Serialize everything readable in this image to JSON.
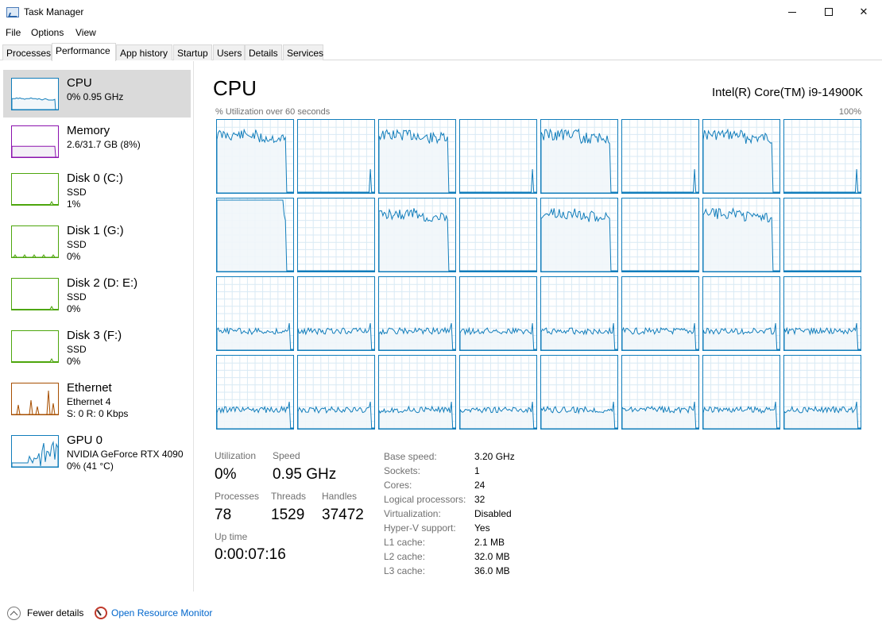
{
  "window": {
    "title": "Task Manager"
  },
  "menu": [
    "File",
    "Options",
    "View"
  ],
  "tabs": [
    "Processes",
    "Performance",
    "App history",
    "Startup",
    "Users",
    "Details",
    "Services"
  ],
  "active_tab": "Performance",
  "sidebar": [
    {
      "name": "CPU",
      "sub1": "0%  0.95 GHz",
      "sub2": "",
      "color": "#117dbb",
      "fill": "#f1f6fa",
      "shape": [
        8,
        8,
        8,
        7,
        8,
        7,
        8,
        8,
        9,
        8,
        8,
        8,
        7,
        8,
        8,
        8,
        9,
        8,
        9,
        10,
        9,
        8,
        9,
        10,
        10,
        10,
        10,
        9,
        40,
        41
      ]
    },
    {
      "name": "Memory",
      "sub1": "2.6/31.7 GB (8%)",
      "sub2": "",
      "color": "#8b12ae",
      "fill": "#f4f0f7",
      "shape": [
        8,
        8,
        8,
        8,
        8,
        8,
        8,
        8,
        8,
        8,
        8,
        8,
        8,
        8,
        8,
        8,
        8,
        8,
        8,
        8,
        8,
        8,
        8,
        8,
        8,
        8,
        8,
        8,
        34,
        34
      ]
    },
    {
      "name": "Disk 0 (C:)",
      "sub1": "SSD",
      "sub2": "1%",
      "color": "#4da60c",
      "fill": "#eff7ea",
      "shape": []
    },
    {
      "name": "Disk 1 (G:)",
      "sub1": "SSD",
      "sub2": "0%",
      "color": "#4da60c",
      "fill": "#eff7ea",
      "shape": []
    },
    {
      "name": "Disk 2 (D: E:)",
      "sub1": "SSD",
      "sub2": "0%",
      "color": "#4da60c",
      "fill": "#eff7ea",
      "shape": []
    },
    {
      "name": "Disk 3 (F:)",
      "sub1": "SSD",
      "sub2": "0%",
      "color": "#4da60c",
      "fill": "#eff7ea",
      "shape": []
    },
    {
      "name": "Ethernet",
      "sub1": "Ethernet 4",
      "sub2": "S: 0  R: 0 Kbps",
      "color": "#a74f01",
      "fill": "#fcf3eb",
      "shape": []
    },
    {
      "name": "GPU 0",
      "sub1": "NVIDIA GeForce RTX 4090",
      "sub2": "0%  (41 °C)",
      "color": "#117dbb",
      "fill": "#f1f6fa",
      "shape": []
    }
  ],
  "header": {
    "title": "CPU",
    "model": "Intel(R) Core(TM) i9-14900K",
    "util_label": "% Utilization over 60 seconds",
    "util_max": "100%"
  },
  "stats": {
    "utilization_label": "Utilization",
    "utilization_value": "0%",
    "speed_label": "Speed",
    "speed_value": "0.95 GHz",
    "processes_label": "Processes",
    "processes_value": "78",
    "threads_label": "Threads",
    "threads_value": "1529",
    "handles_label": "Handles",
    "handles_value": "37472",
    "uptime_label": "Up time",
    "uptime_value": "0:00:07:16"
  },
  "info": [
    {
      "label": "Base speed:",
      "value": "3.20 GHz"
    },
    {
      "label": "Sockets:",
      "value": "1"
    },
    {
      "label": "Cores:",
      "value": "24"
    },
    {
      "label": "Logical processors:",
      "value": "32"
    },
    {
      "label": "Virtualization:",
      "value": "Disabled"
    },
    {
      "label": "Hyper-V support:",
      "value": "Yes"
    },
    {
      "label": "L1 cache:",
      "value": "2.1 MB"
    },
    {
      "label": "L2 cache:",
      "value": "32.0 MB"
    },
    {
      "label": "L3 cache:",
      "value": "36.0 MB"
    }
  ],
  "footer": {
    "fewer_details": "Fewer details",
    "open_resource_monitor": "Open Resource Monitor"
  },
  "colors": {
    "accent": "#117dbb",
    "cell_fill": "#f1f6fa",
    "grid_line": "#d9eaf4",
    "link": "#0066cc"
  }
}
